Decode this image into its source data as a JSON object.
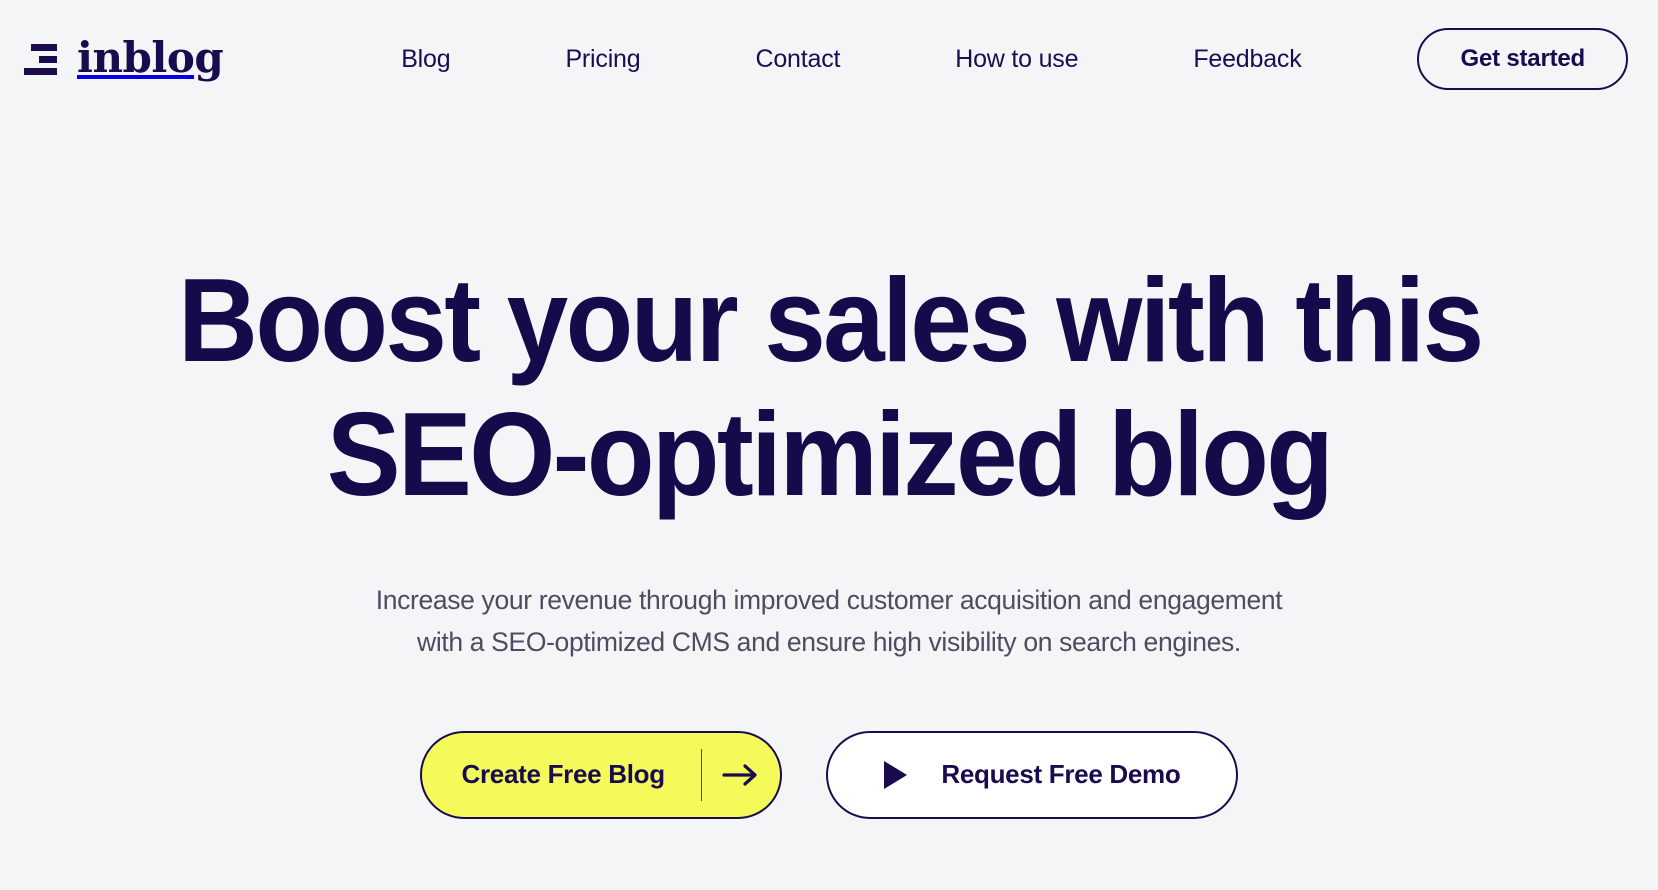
{
  "theme": {
    "background": "#f4f5f7",
    "ink": "#190b4e",
    "ink_deep": "#150a4a",
    "muted_text": "#4c4d60",
    "accent_yellow": "#f4fa5a",
    "surface_white": "#ffffff"
  },
  "header": {
    "brand": {
      "name": "inblog",
      "mark": "three-bars-icon"
    },
    "nav": [
      {
        "label": "Blog"
      },
      {
        "label": "Pricing"
      },
      {
        "label": "Contact"
      },
      {
        "label": "How to use"
      },
      {
        "label": "Feedback"
      }
    ],
    "cta": {
      "label": "Get started"
    }
  },
  "hero": {
    "title_line1": "Boost your sales with this",
    "title_line2": "SEO-optimized blog",
    "subtitle_line1": "Increase your revenue through improved customer acquisition and engagement",
    "subtitle_line2": "with a SEO-optimized CMS and ensure high visibility on search engines.",
    "primary_cta": {
      "label": "Create Free Blog",
      "icon": "arrow-right-icon"
    },
    "secondary_cta": {
      "label": "Request Free Demo",
      "icon": "play-icon"
    }
  }
}
